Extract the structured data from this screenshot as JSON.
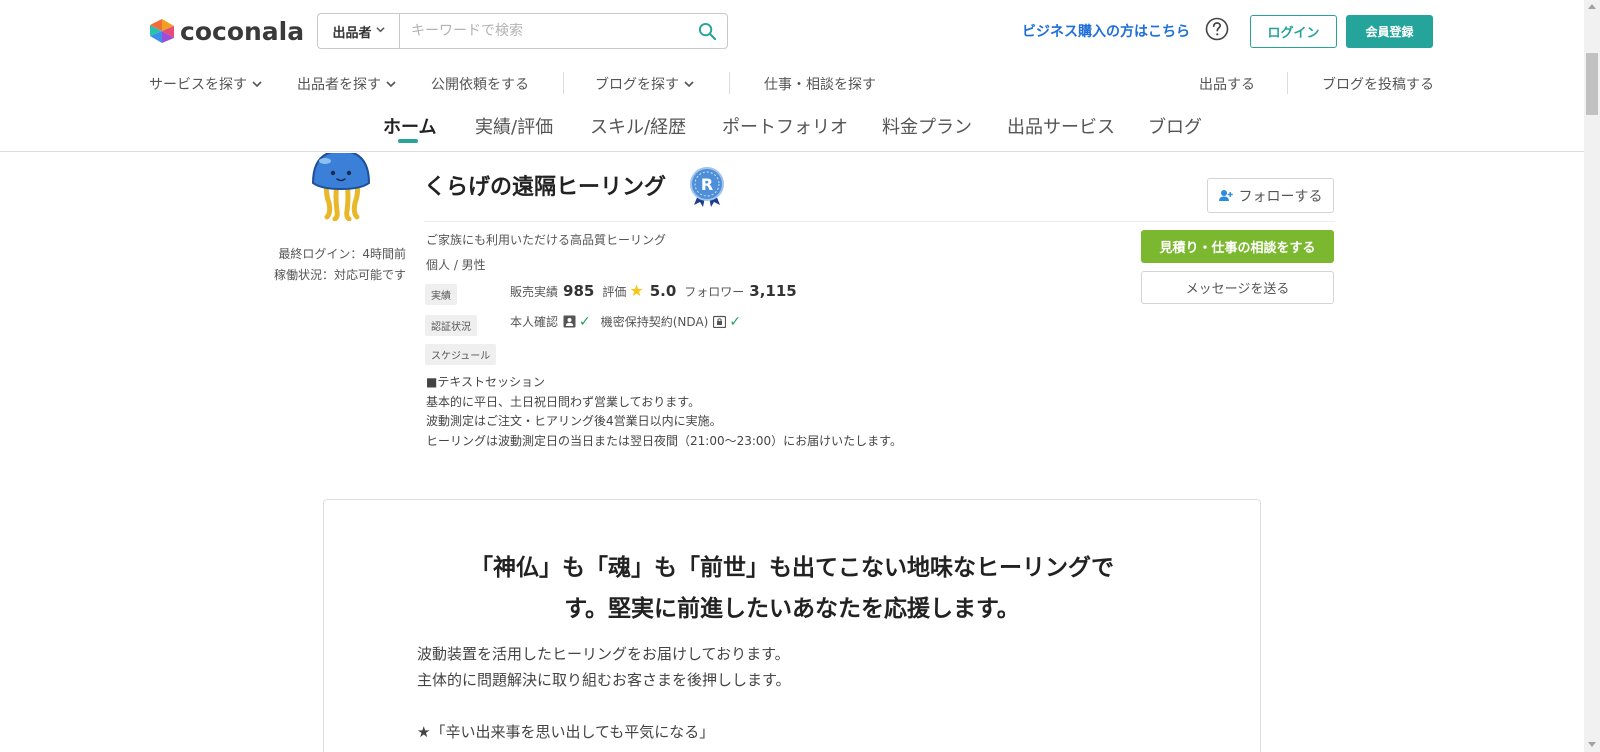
{
  "header": {
    "logo_text": "coconala",
    "search": {
      "type_label": "出品者",
      "placeholder": "キーワードで検索"
    },
    "business_link": "ビジネス購入の方はこちら",
    "login_label": "ログイン",
    "signup_label": "会員登録"
  },
  "gnav": {
    "items": [
      {
        "label": "サービスを探す"
      },
      {
        "label": "出品者を探す"
      },
      {
        "label": "公開依頼をする"
      },
      {
        "label": "ブログを探す"
      },
      {
        "label": "仕事・相談を探す"
      }
    ],
    "right_items": [
      {
        "label": "出品する"
      },
      {
        "label": "ブログを投稿する"
      }
    ]
  },
  "profile_tabs": {
    "tabs": [
      {
        "label": "ホーム",
        "active": true
      },
      {
        "label": "実績/評価"
      },
      {
        "label": "スキル/経歴"
      },
      {
        "label": "ポートフォリオ"
      },
      {
        "label": "料金プラン"
      },
      {
        "label": "出品サービス"
      },
      {
        "label": "ブログ"
      }
    ]
  },
  "profile": {
    "last_login": "最終ログイン：4時間前",
    "work_status": "稼働状況：対応可能です",
    "name": "くらげの遠隔ヒーリング",
    "follow_label": "フォローする",
    "catchphrase": "ご家族にも利用いただける高品質ヒーリング",
    "attributes": "個人 /  男性",
    "labels": {
      "achievements": "実績",
      "verification": "認証状況",
      "schedule": "スケジュール"
    },
    "stats": {
      "sales_label": "販売実績",
      "sales_value": "985",
      "rating_label": "評価",
      "rating_value": "5.0",
      "followers_label": "フォロワー",
      "followers_value": "3,115"
    },
    "verification": {
      "identity_label": "本人確認",
      "nda_label": "機密保持契約(NDA)"
    },
    "schedule_lines": [
      "■テキストセッション",
      "基本的に平日、土日祝日問わず営業しております。",
      "波動測定はご注文・ヒアリング後4営業日以内に実施。",
      "ヒーリングは波動測定日の当日または翌日夜間（21:00〜23:00）にお届けいたします。"
    ],
    "quote_label": "見積り・仕事の相談をする",
    "message_label": "メッセージを送る"
  },
  "intro": {
    "title_line1": "「神仏」も「魂」も「前世」も出てこない地味なヒーリングで",
    "title_line2": "す。堅実に前進したいあなたを応援します。",
    "body_lines": [
      "波動装置を活用したヒーリングをお届けしております。",
      "主体的に問題解決に取り組むお客さまを後押しします。",
      "",
      "★「辛い出来事を思い出しても平気になる」"
    ]
  },
  "colors": {
    "brand_teal": "#24a49a",
    "link_blue": "#1e6fd9",
    "quote_green": "#7cb82f",
    "star": "#f5c518",
    "check": "#27a05a"
  }
}
